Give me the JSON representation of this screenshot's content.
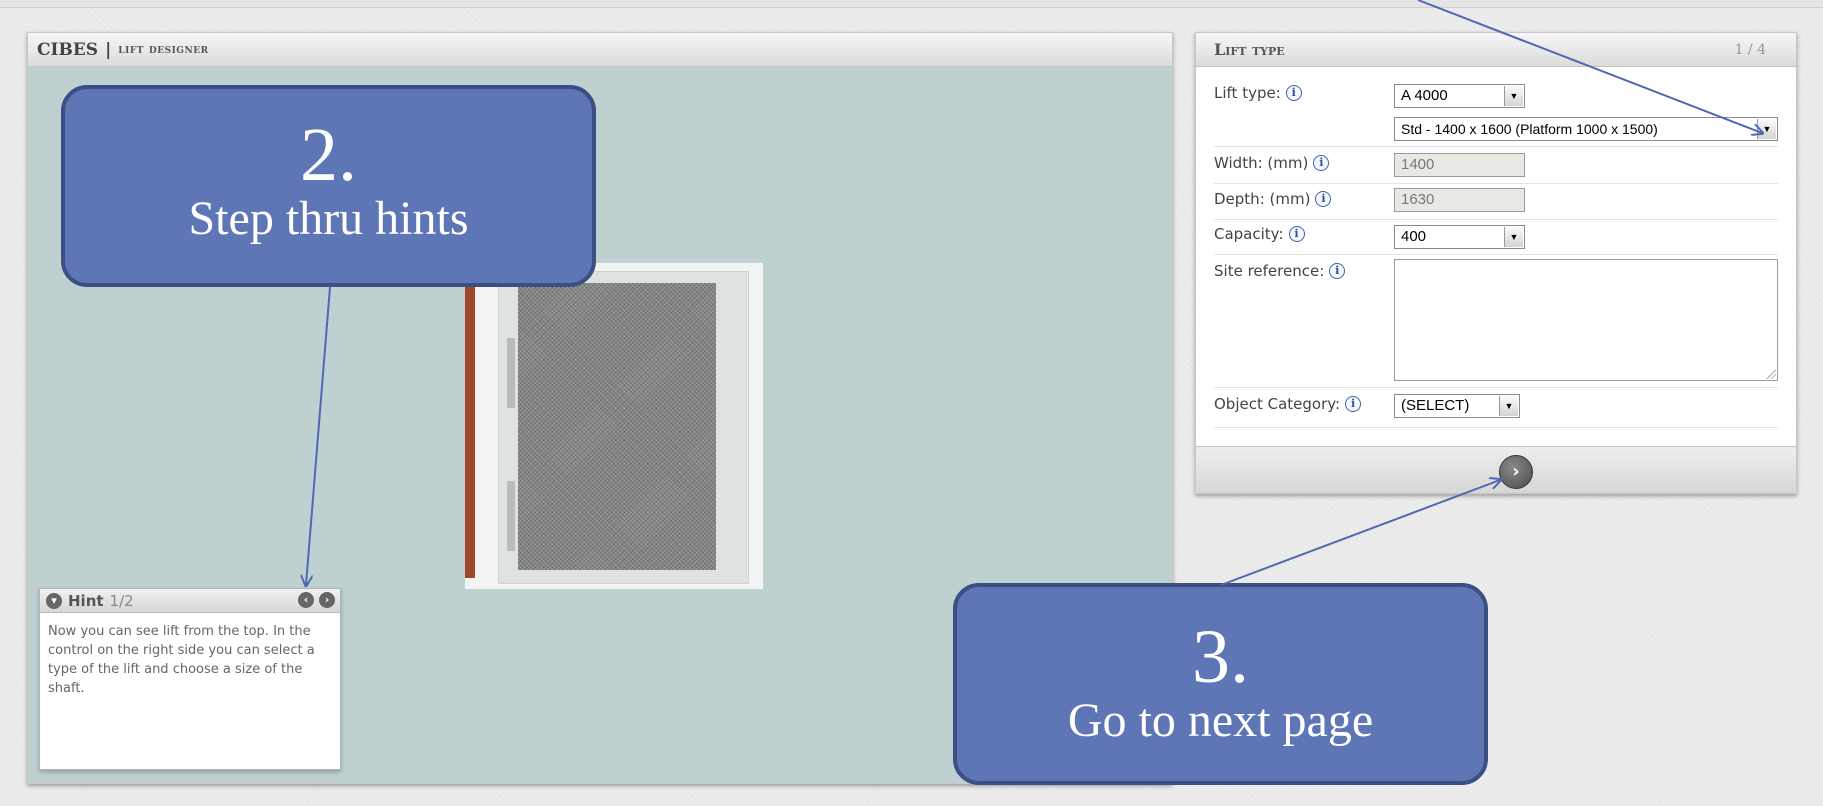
{
  "designer": {
    "brand": "CIBES",
    "brand_sep": "|",
    "subtitle": "lift designer"
  },
  "hint": {
    "title": "Hint",
    "step": "1/2",
    "text": "Now you can see lift from the top. In the control on the right side you can select a type of the lift and choose a size of the shaft.",
    "prev_icon": "chevron-left-icon",
    "next_icon": "chevron-right-icon",
    "collapse_icon": "chevron-down-icon"
  },
  "lift_panel": {
    "title": "Lift type",
    "page": "1 / 4",
    "fields": {
      "lift_type_label": "Lift type:",
      "lift_type_value": "A 4000",
      "size_value": "Std - 1400 x 1600 (Platform 1000 x 1500)",
      "width_label": "Width: (mm)",
      "width_value": "1400",
      "depth_label": "Depth: (mm)",
      "depth_value": "1630",
      "capacity_label": "Capacity:",
      "capacity_value": "400",
      "site_ref_label": "Site reference:",
      "site_ref_value": "",
      "object_cat_label": "Object Category:",
      "object_cat_value": "(SELECT)"
    },
    "next_icon": "chevron-right-icon"
  },
  "callouts": {
    "step2_num": "2.",
    "step2_text": "Step thru hints",
    "step3_num": "3.",
    "step3_text": "Go to next page"
  },
  "colors": {
    "callout_fill": "#5f76b6",
    "callout_border": "#3c4f85",
    "viewport_bg": "#bfd0d1",
    "rail": "#a0462a"
  }
}
